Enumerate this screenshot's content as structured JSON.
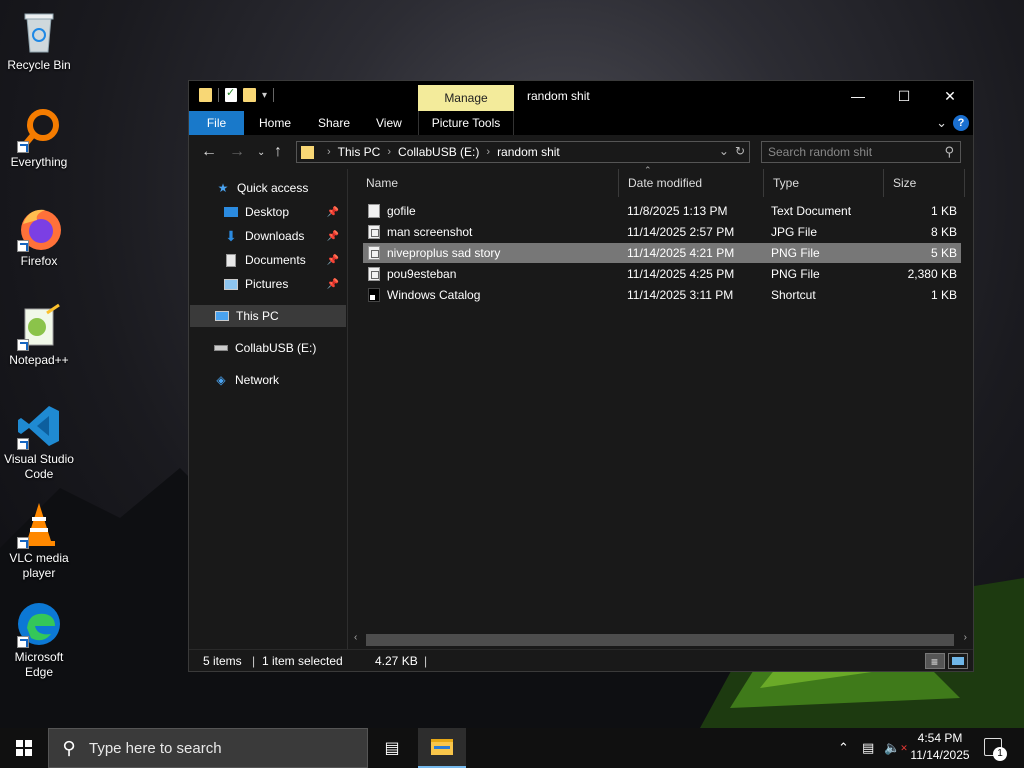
{
  "desktop": {
    "icons": [
      {
        "label": "Recycle Bin"
      },
      {
        "label": "Everything"
      },
      {
        "label": "Firefox"
      },
      {
        "label": "Notepad++"
      },
      {
        "label": "Visual Studio Code"
      },
      {
        "label": "VLC media player"
      },
      {
        "label": "Microsoft Edge"
      }
    ]
  },
  "window": {
    "title": "random shit",
    "context_tab": "Manage",
    "ribbon_tabs": [
      "File",
      "Home",
      "Share",
      "View",
      "Picture Tools"
    ],
    "address": {
      "crumbs": [
        "This PC",
        "CollabUSB (E:)",
        "random shit"
      ]
    },
    "search": {
      "placeholder": "Search random shit"
    },
    "nav": {
      "quick_access": "Quick access",
      "desktop": "Desktop",
      "downloads": "Downloads",
      "documents": "Documents",
      "pictures": "Pictures",
      "this_pc": "This PC",
      "usb": "CollabUSB (E:)",
      "network": "Network"
    },
    "columns": [
      "Name",
      "Date modified",
      "Type",
      "Size"
    ],
    "files": [
      {
        "name": "gofile",
        "date": "11/8/2025 1:13 PM",
        "type": "Text Document",
        "size": "1 KB",
        "icon": "text-file-icon"
      },
      {
        "name": "man screenshot",
        "date": "11/14/2025 2:57 PM",
        "type": "JPG File",
        "size": "8 KB",
        "icon": "image-file-icon"
      },
      {
        "name": "niveproplus sad story",
        "date": "11/14/2025 4:21 PM",
        "type": "PNG File",
        "size": "5 KB",
        "icon": "image-file-icon",
        "selected": true
      },
      {
        "name": "pou9esteban",
        "date": "11/14/2025 4:25 PM",
        "type": "PNG File",
        "size": "2,380 KB",
        "icon": "image-file-icon"
      },
      {
        "name": "Windows Catalog",
        "date": "11/14/2025 3:11 PM",
        "type": "Shortcut",
        "size": "1 KB",
        "icon": "shortcut-icon"
      }
    ],
    "status": {
      "items": "5 items",
      "selected": "1 item selected",
      "size": "4.27 KB"
    }
  },
  "taskbar": {
    "search_text": "Type here to search",
    "time": "4:54 PM",
    "date": "11/14/2025",
    "notifications": "1"
  },
  "colors": {
    "file_tab": "#1979ca",
    "manage_tab": "#f3eb9b",
    "selection": "#777777",
    "folder": "#f8d775"
  }
}
